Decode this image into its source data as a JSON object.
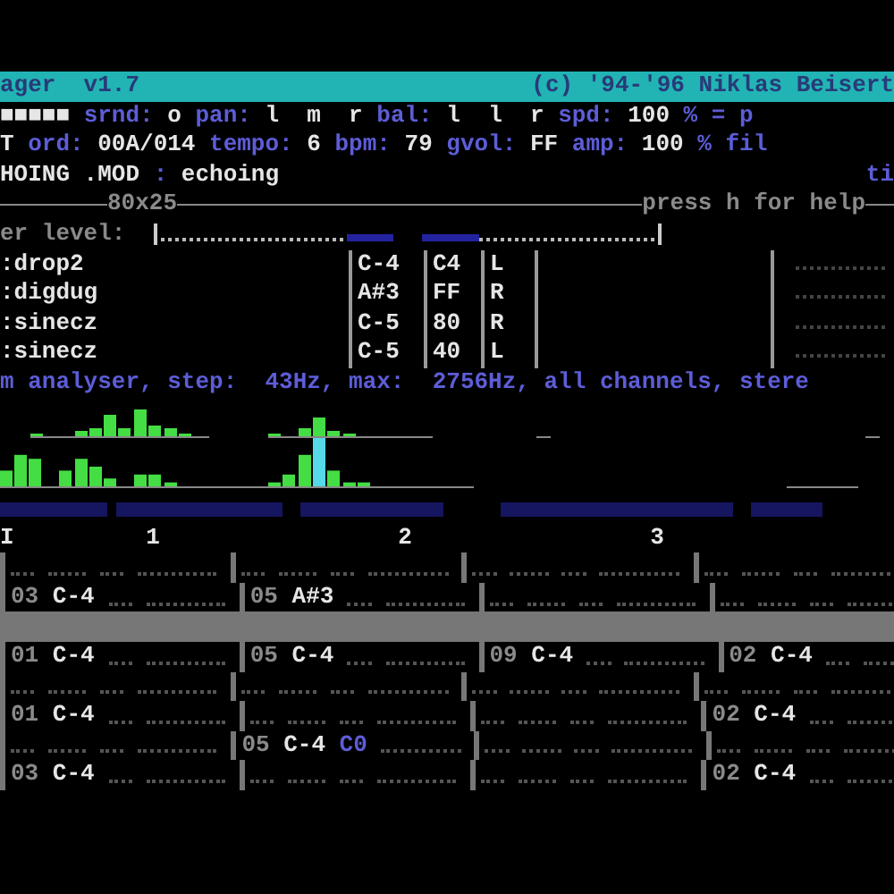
{
  "title_bar": {
    "left": "ager  v1.7",
    "right": "(c) '94-'96 Niklas Beisert"
  },
  "status_lines": [
    [
      {
        "text": "■■■■■",
        "kind": "value"
      },
      {
        "text": "srnd:",
        "kind": "label"
      },
      {
        "text": "o",
        "kind": "value"
      },
      {
        "text": "pan:",
        "kind": "label"
      },
      {
        "text": "l  m  r",
        "kind": "value"
      },
      {
        "text": "bal:",
        "kind": "label"
      },
      {
        "text": "l  l  r",
        "kind": "value"
      },
      {
        "text": "spd:",
        "kind": "label"
      },
      {
        "text": "100",
        "kind": "value"
      },
      {
        "text": "% = p",
        "kind": "label"
      }
    ],
    [
      {
        "text": "T",
        "kind": "value"
      },
      {
        "text": "ord:",
        "kind": "label"
      },
      {
        "text": "00A/014",
        "kind": "value"
      },
      {
        "text": "tempo:",
        "kind": "label"
      },
      {
        "text": "6",
        "kind": "value"
      },
      {
        "text": "bpm:",
        "kind": "label"
      },
      {
        "text": "79",
        "kind": "value"
      },
      {
        "text": "gvol:",
        "kind": "label"
      },
      {
        "text": "FF",
        "kind": "value"
      },
      {
        "text": "amp:",
        "kind": "label"
      },
      {
        "text": "100",
        "kind": "value"
      },
      {
        "text": "% fil",
        "kind": "label"
      }
    ],
    [
      {
        "text": "HOING .MOD",
        "kind": "value"
      },
      {
        "text": ":",
        "kind": "label"
      },
      {
        "text": "echoing",
        "kind": "value"
      }
    ]
  ],
  "status_right": "ti",
  "divider": {
    "left": "80x25",
    "right": "press h for help"
  },
  "master_level": {
    "label": "er level:",
    "channels": [
      {
        "level": 0.2
      },
      {
        "level": 0.25
      }
    ]
  },
  "instruments": [
    {
      "name": ":drop2",
      "note": "C-4",
      "volume": "C4",
      "pan": "L"
    },
    {
      "name": ":digdug",
      "note": "A#3",
      "volume": "FF",
      "pan": "R"
    },
    {
      "name": ":sinecz",
      "note": "C-5",
      "volume": "80",
      "pan": "R"
    },
    {
      "name": ":sinecz",
      "note": "C-5",
      "volume": "40",
      "pan": "L"
    }
  ],
  "analyser": "m analyser, step:  43Hz, max:  2756Hz, all channels, stere",
  "pattern": {
    "row_marker": "I",
    "channels": [
      "1",
      "2",
      "3"
    ],
    "rows": [
      {
        "selected": false,
        "cells": [
          {},
          {},
          {},
          {}
        ]
      },
      {
        "selected": false,
        "cells": [
          {
            "ins": "03",
            "note": "C-4"
          },
          {
            "ins": "05",
            "note": "A#3"
          },
          {},
          {}
        ]
      },
      {
        "selected": true,
        "cells": [
          {},
          {},
          {},
          {}
        ]
      },
      {
        "selected": false,
        "cells": [
          {
            "ins": "01",
            "note": "C-4"
          },
          {
            "ins": "05",
            "note": "C-4"
          },
          {
            "ins": "09",
            "note": "C-4"
          },
          {
            "ins": "02",
            "note": "C-4"
          }
        ]
      },
      {
        "selected": false,
        "cells": [
          {},
          {},
          {},
          {}
        ]
      },
      {
        "selected": false,
        "cells": [
          {
            "ins": "01",
            "note": "C-4"
          },
          {},
          {},
          {
            "ins": "02",
            "note": "C-4"
          }
        ]
      },
      {
        "selected": false,
        "cells": [
          {},
          {
            "ins": "05",
            "note": "C-4",
            "volume": "C0"
          },
          {},
          {}
        ]
      },
      {
        "selected": false,
        "cells": [
          {
            "ins": "03",
            "note": "C-4"
          },
          {},
          {},
          {
            "ins": "02",
            "note": "C-4"
          }
        ]
      }
    ]
  }
}
